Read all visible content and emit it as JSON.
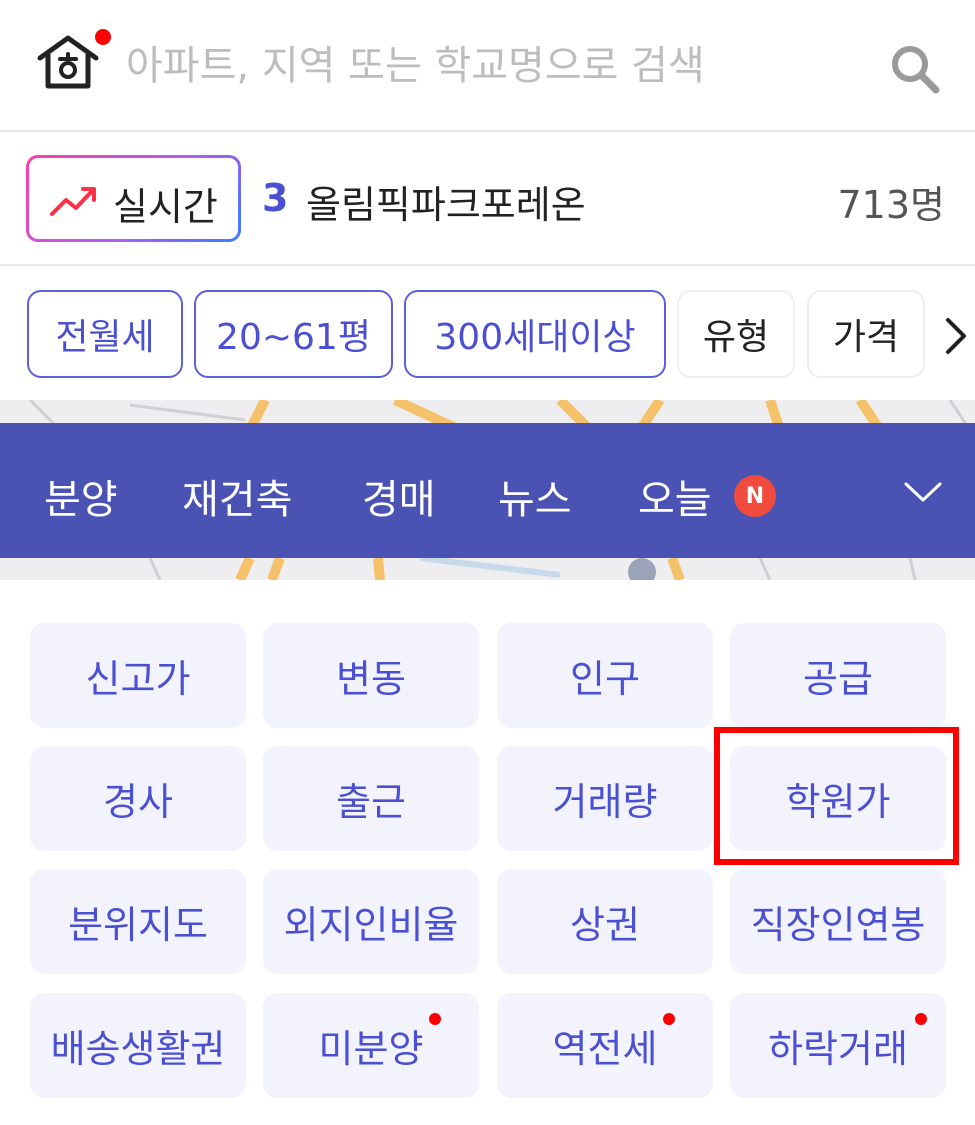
{
  "search": {
    "placeholder": "아파트, 지역 또는 학교명으로 검색"
  },
  "realtime": {
    "badge_label": "실시간",
    "rank": "3",
    "title": "올림픽파크포레온",
    "count": "713명"
  },
  "filters": {
    "chips": [
      {
        "label": "전월세",
        "active": true
      },
      {
        "label": "20~61평",
        "active": true
      },
      {
        "label": "300세대이상",
        "active": true
      },
      {
        "label": "유형",
        "active": false
      },
      {
        "label": "가격",
        "active": false
      }
    ]
  },
  "menu": {
    "items": [
      "분양",
      "재건축",
      "경매",
      "뉴스",
      "오늘"
    ],
    "new_badge": "N"
  },
  "grid": {
    "items": [
      {
        "label": "신고가",
        "dot": false
      },
      {
        "label": "변동",
        "dot": false
      },
      {
        "label": "인구",
        "dot": false
      },
      {
        "label": "공급",
        "dot": false
      },
      {
        "label": "경사",
        "dot": false
      },
      {
        "label": "출근",
        "dot": false
      },
      {
        "label": "거래량",
        "dot": false
      },
      {
        "label": "학원가",
        "dot": false
      },
      {
        "label": "분위지도",
        "dot": false
      },
      {
        "label": "외지인비율",
        "dot": false
      },
      {
        "label": "상권",
        "dot": false
      },
      {
        "label": "직장인연봉",
        "dot": false
      },
      {
        "label": "배송생활권",
        "dot": false
      },
      {
        "label": "미분양",
        "dot": true
      },
      {
        "label": "역전세",
        "dot": true
      },
      {
        "label": "하락거래",
        "dot": true
      }
    ]
  },
  "colors": {
    "accent": "#4a50d1",
    "menu_bg": "#4a53b3",
    "highlight": "#ff0000"
  }
}
